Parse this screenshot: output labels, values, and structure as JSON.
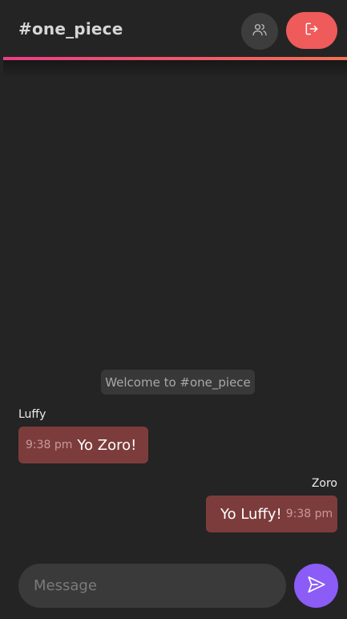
{
  "header": {
    "channel_title": "#one_piece",
    "users_icon": "users-icon",
    "logout_icon": "logout-icon"
  },
  "chat": {
    "welcome": "Welcome to #one_piece",
    "messages": [
      {
        "sender": "Luffy",
        "time": "9:38 pm",
        "text": "Yo Zoro!",
        "side": "left"
      },
      {
        "sender": "Zoro",
        "time": "9:38 pm",
        "text": "Yo Luffy!",
        "side": "right"
      }
    ]
  },
  "composer": {
    "placeholder": "Message",
    "value": "",
    "send_icon": "send-icon"
  },
  "colors": {
    "background": "#242424",
    "logout_button": "#ef5a5a",
    "send_button": "#8b5cf6",
    "bubble": "#7d3c3c",
    "accent_gradient_start": "#ea3f86",
    "accent_gradient_end": "#f17254"
  }
}
